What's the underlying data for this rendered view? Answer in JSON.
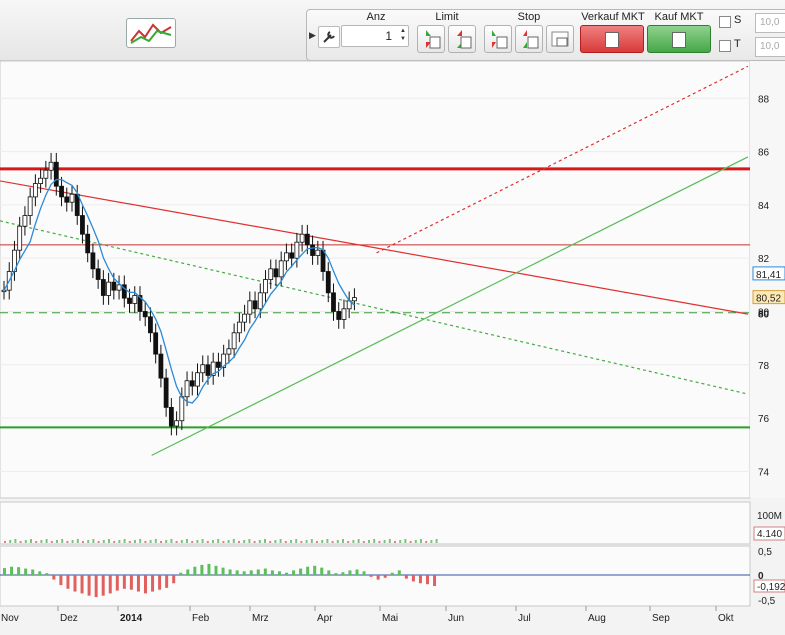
{
  "toolbar": {
    "anz_label": "Anz",
    "limit_label": "Limit",
    "stop_label": "Stop",
    "verkauf_label": "Verkauf MKT",
    "kauf_label": "Kauf MKT",
    "quantity_value": "1",
    "s_label": "S",
    "t_label": "T",
    "s_value": "10,0",
    "t_value": "10,0"
  },
  "chart_data": [
    {
      "type": "candlestick",
      "title": "",
      "y_ticks": [
        "74",
        "76",
        "78",
        "80",
        "82",
        "84",
        "86",
        "88"
      ],
      "ylim": [
        73.0,
        89.4
      ],
      "x_ticks": [
        "Nov",
        "Dez",
        "2014",
        "Feb",
        "Mrz",
        "Apr",
        "Mai",
        "Jun",
        "Jul",
        "Aug",
        "Sep",
        "Okt"
      ],
      "price_labels": {
        "moving_average": "81,41",
        "last": "80,52",
        "level": "80"
      },
      "close_values": [
        80.8,
        81.5,
        82.3,
        83.2,
        83.6,
        84.3,
        84.8,
        85.0,
        85.3,
        85.6,
        84.7,
        84.3,
        84.1,
        84.4,
        83.6,
        82.9,
        82.2,
        81.6,
        81.2,
        80.6,
        81.1,
        80.8,
        81.0,
        80.5,
        80.3,
        80.6,
        80.0,
        79.8,
        79.2,
        78.4,
        77.5,
        76.4,
        75.7,
        75.9,
        76.8,
        77.4,
        77.2,
        77.7,
        78.0,
        77.6,
        78.1,
        77.9,
        78.4,
        78.6,
        79.2,
        79.6,
        79.9,
        80.4,
        80.1,
        80.7,
        81.2,
        81.6,
        81.3,
        81.9,
        82.2,
        82.0,
        82.6,
        82.9,
        82.5,
        82.1,
        82.3,
        81.5,
        80.7,
        80.0,
        79.7,
        80.1,
        80.4,
        80.52
      ],
      "horizontal_lines": [
        85.35,
        82.5,
        79.95,
        75.65
      ],
      "trendlines": [
        {
          "name": "resistance",
          "from": [
            0,
            84.9
          ],
          "to": [
            143,
            79.9
          ]
        },
        {
          "name": "support",
          "from": [
            29,
            74.6
          ],
          "to": [
            143,
            85.8
          ]
        },
        {
          "name": "support-extension",
          "from": [
            72,
            82.2
          ],
          "to": [
            143,
            89.2
          ]
        },
        {
          "name": "trend-dotted",
          "from": [
            0,
            83.4
          ],
          "to": [
            143,
            76.9
          ]
        }
      ]
    },
    {
      "type": "bar",
      "title": "Volume",
      "y_ticks": [
        "100M"
      ],
      "value_label": "4.140"
    },
    {
      "type": "bar",
      "title": "Oscillator",
      "y_ticks": [
        "0,5",
        "0",
        "-0,5"
      ],
      "value_label": "-0,192",
      "values": [
        0.15,
        0.18,
        0.17,
        0.14,
        0.12,
        0.08,
        0.04,
        -0.1,
        -0.22,
        -0.3,
        -0.36,
        -0.4,
        -0.45,
        -0.48,
        -0.45,
        -0.4,
        -0.34,
        -0.3,
        -0.32,
        -0.36,
        -0.4,
        -0.36,
        -0.32,
        -0.28,
        -0.18,
        0.05,
        0.12,
        0.18,
        0.22,
        0.24,
        0.2,
        0.16,
        0.12,
        0.1,
        0.08,
        0.1,
        0.12,
        0.14,
        0.1,
        0.08,
        0.05,
        0.1,
        0.14,
        0.18,
        0.2,
        0.16,
        0.1,
        0.04,
        0.06,
        0.1,
        0.12,
        0.08,
        -0.04,
        -0.1,
        -0.06,
        0.05,
        0.1,
        -0.08,
        -0.14,
        -0.18,
        -0.2,
        -0.24
      ]
    }
  ]
}
